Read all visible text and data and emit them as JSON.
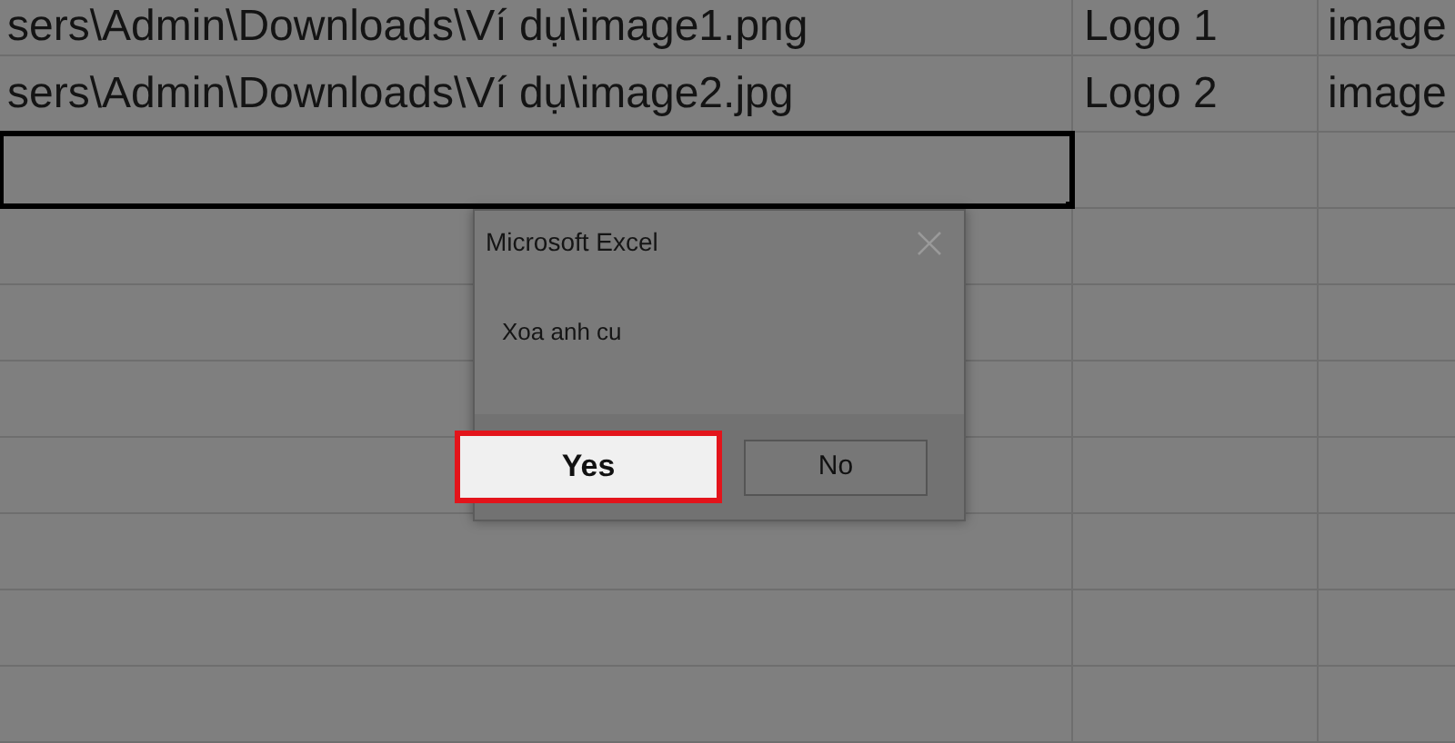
{
  "sheet": {
    "rows": [
      {
        "column_1": "sers\\Admin\\Downloads\\Ví dụ\\image1.png",
        "column_2": "Logo 1",
        "column_3": "image",
        "selected": false
      },
      {
        "column_1": "sers\\Admin\\Downloads\\Ví dụ\\image2.jpg",
        "column_2": "Logo 2",
        "column_3": "image",
        "selected": false
      },
      {
        "selected": true
      }
    ]
  },
  "dialog": {
    "title": "Microsoft Excel",
    "message": "Xoa anh cu",
    "buttons": [
      {
        "label": "Yes",
        "focused": true
      },
      {
        "label": "No",
        "focused": false
      }
    ]
  }
}
